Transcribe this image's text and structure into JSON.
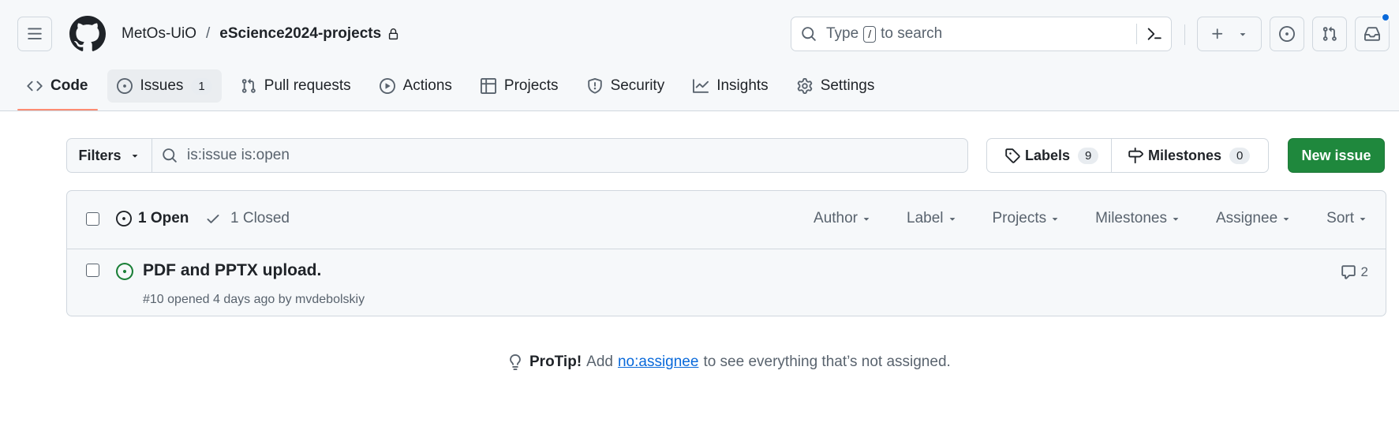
{
  "header": {
    "owner": "MetOs-UiO",
    "separator": "/",
    "repo": "eScience2024-projects",
    "search": {
      "prefix": "Type",
      "key": "/",
      "suffix": "to search"
    }
  },
  "repo_nav": {
    "tabs": [
      {
        "label": "Code",
        "icon": "code-icon",
        "selected": true
      },
      {
        "label": "Issues",
        "icon": "issue-opened-icon",
        "count": "1"
      },
      {
        "label": "Pull requests",
        "icon": "git-pull-request-icon"
      },
      {
        "label": "Actions",
        "icon": "play-icon"
      },
      {
        "label": "Projects",
        "icon": "table-icon"
      },
      {
        "label": "Security",
        "icon": "shield-icon"
      },
      {
        "label": "Insights",
        "icon": "graph-icon"
      },
      {
        "label": "Settings",
        "icon": "gear-icon"
      }
    ]
  },
  "filters": {
    "button_label": "Filters",
    "query": "is:issue is:open",
    "labels_label": "Labels",
    "labels_count": "9",
    "milestones_label": "Milestones",
    "milestones_count": "0",
    "new_issue_label": "New issue"
  },
  "issues_box": {
    "open_label": "1 Open",
    "closed_label": "1 Closed",
    "menus": [
      "Author",
      "Label",
      "Projects",
      "Milestones",
      "Assignee",
      "Sort"
    ],
    "issues": [
      {
        "title": "PDF and PPTX upload.",
        "meta": "#10 opened 4 days ago by mvdebolskiy",
        "comments": "2"
      }
    ]
  },
  "protip": {
    "bold": "ProTip!",
    "before": "Add",
    "link": "no:assignee",
    "after": "to see everything that’s not assigned."
  },
  "colors": {
    "accent_blue": "#0969da",
    "success_green": "#1f883d",
    "open_icon_green": "#1a7f37",
    "tab_underline": "#fd8c73"
  }
}
